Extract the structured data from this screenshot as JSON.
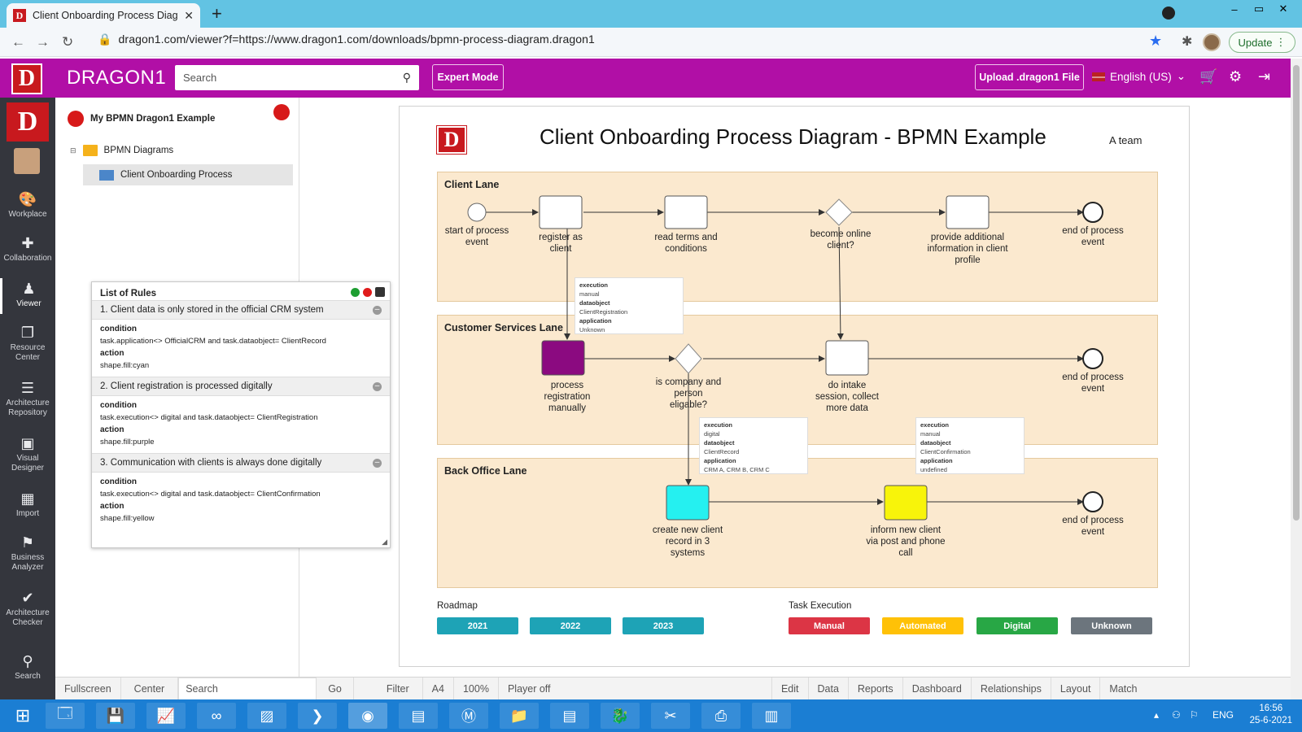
{
  "browser": {
    "tab_title": "Client Onboarding Process Diagr",
    "tab_close": "✕",
    "new_tab": "+",
    "url": "dragon1.com/viewer?f=https://www.dragon1.com/downloads/bpmn-process-diagram.dragon1",
    "update_label": "Update",
    "window_min": "–",
    "window_max": "▭",
    "window_close": "✕"
  },
  "header": {
    "logo_letter": "D",
    "brand": "DRAGON1",
    "search_placeholder": "Search",
    "expert_mode": "Expert Mode",
    "upload": "Upload .dragon1 File",
    "language": "English (US)"
  },
  "sidebar": {
    "logo_letter": "D",
    "items": [
      {
        "label": "Workplace",
        "icon": "palette-icon",
        "glyph": "🎨"
      },
      {
        "label": "Collaboration",
        "icon": "puzzle-icon",
        "glyph": "✚"
      },
      {
        "label": "Viewer",
        "icon": "person-icon",
        "glyph": "♟"
      },
      {
        "label": "Resource Center",
        "icon": "copy-icon",
        "glyph": "❐"
      },
      {
        "label": "Architecture Repository",
        "icon": "database-icon",
        "glyph": "☰"
      },
      {
        "label": "Visual Designer",
        "icon": "image-icon",
        "glyph": "▣"
      },
      {
        "label": "Import",
        "icon": "table-icon",
        "glyph": "▦"
      },
      {
        "label": "Business Analyzer",
        "icon": "flag-icon",
        "glyph": "⚑"
      },
      {
        "label": "Architecture Checker",
        "icon": "check-icon",
        "glyph": "✔"
      },
      {
        "label": "Search",
        "icon": "search-icon",
        "glyph": "⚲"
      }
    ]
  },
  "tree": {
    "root": "My BPMN Dragon1 Example",
    "folder": "BPMN Diagrams",
    "item": "Client Onboarding Process"
  },
  "rules": {
    "title": "List of Rules",
    "condition_label": "condition",
    "action_label": "action",
    "items": [
      {
        "title": "1. Client data is only stored in the official CRM system",
        "condition": "task.application<> OfficialCRM and task.dataobject= ClientRecord",
        "action": "shape.fill:cyan"
      },
      {
        "title": "2. Client registration is processed digitally",
        "condition": "task.execution<> digital and task.dataobject= ClientRegistration",
        "action": "shape.fill:purple"
      },
      {
        "title": "3. Communication with clients is always done digitally",
        "condition": "task.execution<> digital and task.dataobject= ClientConfirmation",
        "action": "shape.fill:yellow"
      }
    ]
  },
  "diagram": {
    "logo_letter": "D",
    "title": "Client Onboarding Process Diagram - BPMN Example",
    "owner": "A team",
    "lanes": [
      "Client Lane",
      "Customer Services Lane",
      "Back Office Lane"
    ],
    "labels": {
      "start": "start of process event",
      "register": "register as client",
      "read_terms": "read terms and conditions",
      "online": "become online client?",
      "provide": "provide additional information in client profile",
      "end1": "end of process event",
      "process_manual": "process registration manually",
      "eligable": "is company and person eligable?",
      "intake": "do intake session, collect more data",
      "end2": "end of process event",
      "create_record": "create new client record in 3 systems",
      "inform": "inform new client via post and phone call",
      "end3": "end of process event"
    },
    "notes": [
      {
        "execution_label": "execution",
        "execution": "manual",
        "dataobject_label": "dataobject",
        "dataobject": "ClientRegistration",
        "application_label": "application",
        "application": "Unknown"
      },
      {
        "execution_label": "execution",
        "execution": "digital",
        "dataobject_label": "dataobject",
        "dataobject": "ClientRecord",
        "application_label": "application",
        "application": "CRM A, CRM B, CRM C"
      },
      {
        "execution_label": "execution",
        "execution": "manual",
        "dataobject_label": "dataobject",
        "dataobject": "ClientConfirmation",
        "application_label": "application",
        "application": "undefined"
      }
    ],
    "colors": {
      "purple_task": "#8b0a80",
      "cyan_task": "#25f0f0",
      "yellow_task": "#f8f40a",
      "lane_fill": "#fbe9cf"
    },
    "roadmap_label": "Roadmap",
    "roadmap": [
      "2021",
      "2022",
      "2023"
    ],
    "roadmap_color": "#1ea3b6",
    "execution_label": "Task Execution",
    "execution": [
      {
        "label": "Manual",
        "color": "#dc3545"
      },
      {
        "label": "Automated",
        "color": "#ffc107"
      },
      {
        "label": "Digital",
        "color": "#28a745"
      },
      {
        "label": "Unknown",
        "color": "#6c757d"
      }
    ]
  },
  "bottombar": {
    "items_left": [
      "Fullscreen",
      "Center"
    ],
    "search": "Search",
    "items_mid": [
      "Go",
      "Filter",
      "A4",
      "100%",
      "Player off"
    ],
    "items_right": [
      "Edit",
      "Data",
      "Reports",
      "Dashboard",
      "Relationships",
      "Layout",
      "Match"
    ]
  },
  "taskbar": {
    "language": "ENG",
    "time": "16:56",
    "date": "25-6-2021"
  }
}
